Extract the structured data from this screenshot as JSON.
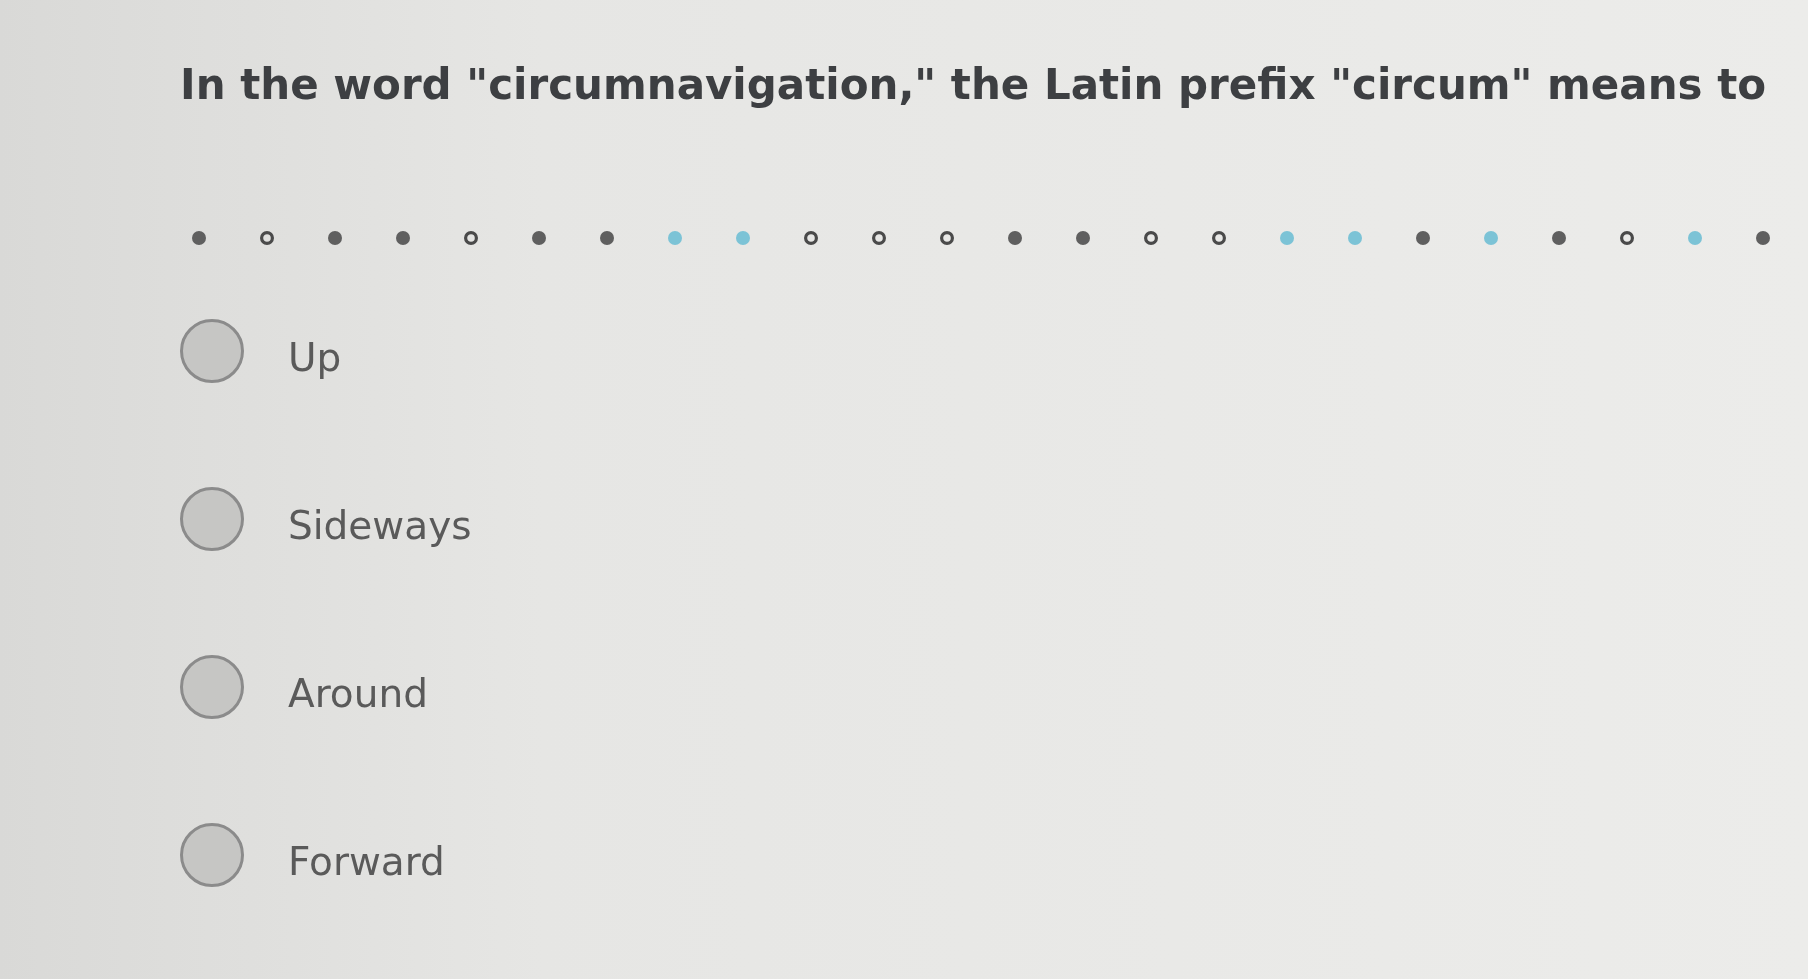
{
  "question": {
    "text": "In the word \"circumnavigation,\" the Latin prefix \"circum\" means to"
  },
  "progress": {
    "dots": [
      {
        "kind": "filled",
        "color": "#5f5f5f"
      },
      {
        "kind": "ring",
        "color": "#4a4a4a"
      },
      {
        "kind": "filled",
        "color": "#5f5f5f"
      },
      {
        "kind": "filled",
        "color": "#5f5f5f"
      },
      {
        "kind": "ring",
        "color": "#4a4a4a"
      },
      {
        "kind": "filled",
        "color": "#5f5f5f"
      },
      {
        "kind": "filled",
        "color": "#5f5f5f"
      },
      {
        "kind": "filled",
        "color": "#7cc3d6"
      },
      {
        "kind": "filled",
        "color": "#7cc3d6"
      },
      {
        "kind": "ring",
        "color": "#4a4a4a"
      },
      {
        "kind": "ring",
        "color": "#4a4a4a"
      },
      {
        "kind": "ring",
        "color": "#4a4a4a"
      },
      {
        "kind": "filled",
        "color": "#5f5f5f"
      },
      {
        "kind": "filled",
        "color": "#5f5f5f"
      },
      {
        "kind": "ring",
        "color": "#4a4a4a"
      },
      {
        "kind": "ring",
        "color": "#4a4a4a"
      },
      {
        "kind": "filled",
        "color": "#7cc3d6"
      },
      {
        "kind": "filled",
        "color": "#7cc3d6"
      },
      {
        "kind": "filled",
        "color": "#5f5f5f"
      },
      {
        "kind": "filled",
        "color": "#7cc3d6"
      },
      {
        "kind": "filled",
        "color": "#5f5f5f"
      },
      {
        "kind": "ring",
        "color": "#4a4a4a"
      },
      {
        "kind": "filled",
        "color": "#7cc3d6"
      },
      {
        "kind": "filled",
        "color": "#5f5f5f"
      }
    ]
  },
  "options": [
    {
      "label": "Up",
      "selected": false
    },
    {
      "label": "Sideways",
      "selected": false
    },
    {
      "label": "Around",
      "selected": false
    },
    {
      "label": "Forward",
      "selected": false
    }
  ]
}
